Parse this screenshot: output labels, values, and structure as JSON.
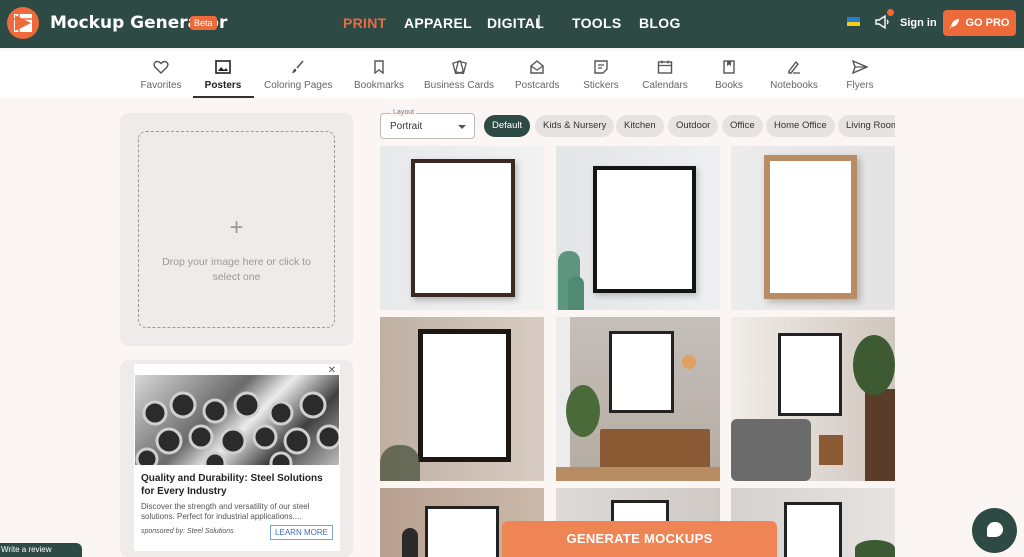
{
  "app": {
    "name": "Mockup Generator",
    "badge": "Beta"
  },
  "topnav": {
    "items": [
      "PRINT",
      "APPAREL",
      "DIGITAL",
      "TOOLS",
      "BLOG"
    ],
    "separator": "|",
    "active": "PRINT"
  },
  "account": {
    "signin": "Sign in",
    "gopro": "GO PRO"
  },
  "categories": [
    {
      "label": "Favorites",
      "icon": "heart-icon"
    },
    {
      "label": "Posters",
      "icon": "poster-icon"
    },
    {
      "label": "Coloring Pages",
      "icon": "brush-icon"
    },
    {
      "label": "Bookmarks",
      "icon": "bookmark-icon"
    },
    {
      "label": "Business Cards",
      "icon": "cards-icon"
    },
    {
      "label": "Postcards",
      "icon": "postcard-icon"
    },
    {
      "label": "Stickers",
      "icon": "sticker-icon"
    },
    {
      "label": "Calendars",
      "icon": "calendar-icon"
    },
    {
      "label": "Books",
      "icon": "book-icon"
    },
    {
      "label": "Notebooks",
      "icon": "notebook-icon"
    },
    {
      "label": "Flyers",
      "icon": "flyer-icon"
    }
  ],
  "active_category": "Posters",
  "upload": {
    "plus": "+",
    "text": "Drop your image here or click to select one"
  },
  "ad": {
    "close": "✕",
    "title": "Quality and Durability: Steel Solutions for Every Industry",
    "description": "Discover the strength and versatility of our steel solutions. Perfect for industrial applications....",
    "sponsor": "sponsored by: Steel Solutions",
    "cta": "LEARN MORE"
  },
  "review": {
    "label": "Write a review"
  },
  "filters": {
    "layout_label": "Layout",
    "layout_value": "Portrait",
    "chips": [
      "Default",
      "Kids & Nursery",
      "Kitchen",
      "Outdoor",
      "Office",
      "Home Office",
      "Living Room"
    ],
    "active_chip": "Default"
  },
  "generate": {
    "label": "GENERATE MOCKUPS"
  },
  "colors": {
    "brand_dark": "#2e4a44",
    "accent": "#ef6a3a"
  }
}
